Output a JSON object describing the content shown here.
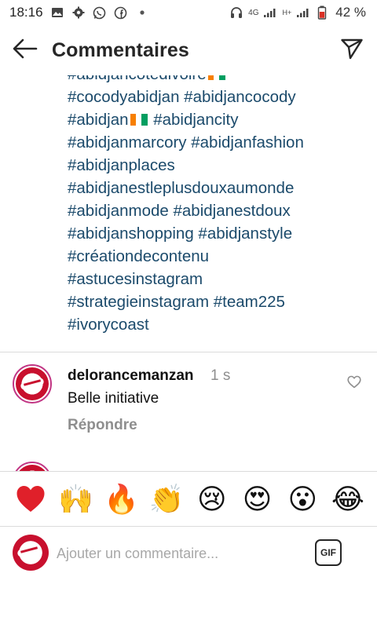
{
  "status_bar": {
    "time": "18:16",
    "network_label": "4G",
    "hplus_label": "H+",
    "battery_percent": "42 %"
  },
  "header": {
    "title": "Commentaires"
  },
  "caption": {
    "lines": [
      "#abidjancotedivoire",
      "#cocodyabidjan #abidjancocody",
      "#abidjan",
      "#abidjanmarcory #abidjanfashion",
      "#abidjanplaces",
      "#abidjanestleplusdouxaumonde",
      "#abidjanmode #abidjanestdoux",
      "#abidjanshopping #abidjanstyle",
      "#créationdecontenu",
      "#astucesinstagram",
      "#strategieinstagram #team225",
      "#ivorycoast"
    ],
    "line3_suffix": "#abidjancity",
    "flag_colors": [
      "#f77f00",
      "#ffffff",
      "#009e60"
    ]
  },
  "comment": {
    "author": "delorancemanzan",
    "time": "1 s",
    "text": "Belle initiative",
    "reply_label": "Répondre"
  },
  "emoji_bar": {
    "emojis": [
      "❤️",
      "🙌",
      "🔥",
      "👏",
      "😢",
      "😍",
      "😮",
      "😂"
    ]
  },
  "composer": {
    "placeholder": "Ajouter un commentaire...",
    "gif_label": "GIF"
  },
  "colors": {
    "hashtag": "#1b4a6b",
    "muted": "#8e8e8e",
    "divider": "#dbdbdb",
    "avatar_ring": "#c13584"
  }
}
